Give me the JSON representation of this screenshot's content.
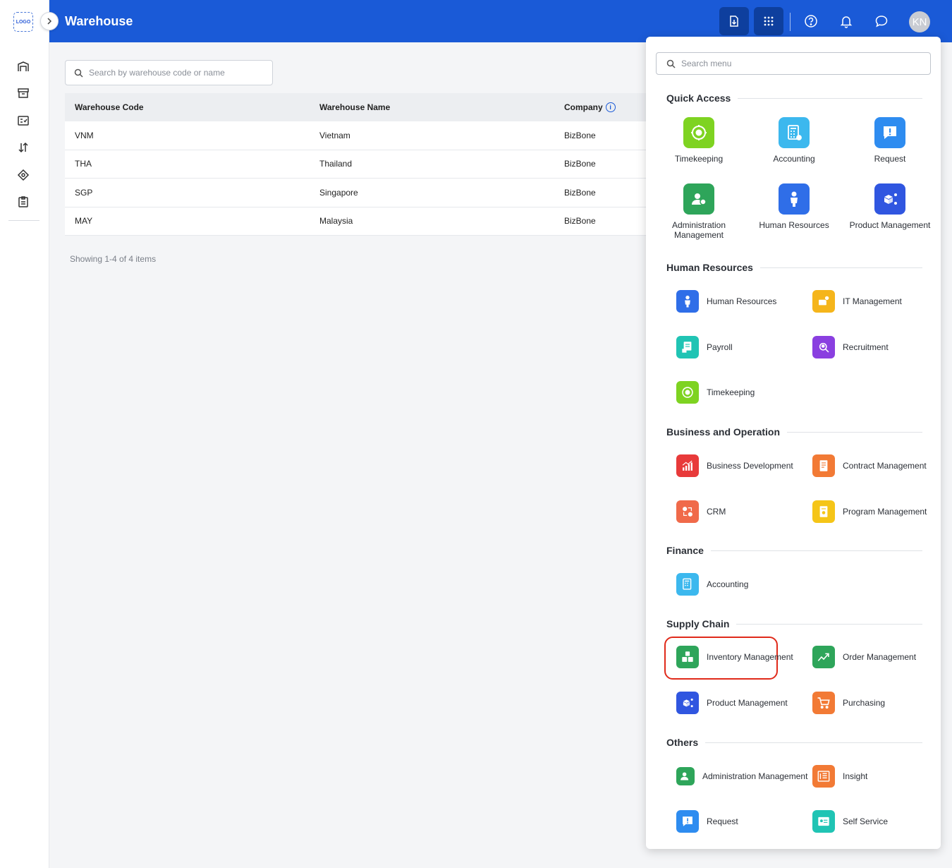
{
  "app": {
    "logo_text": "LOGO",
    "title": "Warehouse",
    "avatar_initials": "KN",
    "accent_color": "#1a5ad7"
  },
  "rail": {
    "icons": [
      "warehouse-icon",
      "archive-icon",
      "checklist-icon",
      "sort-icon",
      "tag-icon",
      "clipboard-icon"
    ]
  },
  "search": {
    "placeholder": "Search by warehouse code or name"
  },
  "table": {
    "columns": [
      "Warehouse Code",
      "Warehouse Name",
      "Company"
    ],
    "rows": [
      [
        "VNM",
        "Vietnam",
        "BizBone"
      ],
      [
        "THA",
        "Thailand",
        "BizBone"
      ],
      [
        "SGP",
        "Singapore",
        "BizBone"
      ],
      [
        "MAY",
        "Malaysia",
        "BizBone"
      ]
    ],
    "info_glyph": "i"
  },
  "footer": {
    "showing": "Showing 1-4 of 4 items"
  },
  "menu": {
    "search_placeholder": "Search menu",
    "quick_access": {
      "title": "Quick Access",
      "items": [
        {
          "label": "Timekeeping",
          "icon": "timekeeping-icon",
          "color": "#7ed321"
        },
        {
          "label": "Accounting",
          "icon": "accounting-icon",
          "color": "#3cb8ee"
        },
        {
          "label": "Request",
          "icon": "request-icon",
          "color": "#2e8cf0"
        },
        {
          "label": "Administration Management",
          "icon": "admin-icon",
          "color": "#2ea55a"
        },
        {
          "label": "Human Resources",
          "icon": "hr-icon",
          "color": "#2f6ee8"
        },
        {
          "label": "Product Management",
          "icon": "product-icon",
          "color": "#3056e0"
        }
      ]
    },
    "human_resources": {
      "title": "Human Resources",
      "items": [
        {
          "label": "Human Resources",
          "icon": "hr-icon",
          "color": "#2f6ee8"
        },
        {
          "label": "IT Management",
          "icon": "it-icon",
          "color": "#f5b51b"
        },
        {
          "label": "Payroll",
          "icon": "payroll-icon",
          "color": "#20c4b4"
        },
        {
          "label": "Recruitment",
          "icon": "recruitment-icon",
          "color": "#8a3fe0"
        },
        {
          "label": "Timekeeping",
          "icon": "timekeeping-icon",
          "color": "#7ed321"
        }
      ]
    },
    "business": {
      "title": "Business and Operation",
      "items": [
        {
          "label": "Business Development",
          "icon": "business-icon",
          "color": "#e83a3a"
        },
        {
          "label": "Contract Management",
          "icon": "contract-icon",
          "color": "#f27a35"
        },
        {
          "label": "CRM",
          "icon": "crm-icon",
          "color": "#f06a4a"
        },
        {
          "label": "Program Management",
          "icon": "program-icon",
          "color": "#f5c518"
        }
      ]
    },
    "finance": {
      "title": "Finance",
      "items": [
        {
          "label": "Accounting",
          "icon": "accounting-icon",
          "color": "#3cb8ee"
        }
      ]
    },
    "supply_chain": {
      "title": "Supply Chain",
      "items": [
        {
          "label": "Inventory Management",
          "icon": "inventory-icon",
          "color": "#2ea55a"
        },
        {
          "label": "Order Management",
          "icon": "order-icon",
          "color": "#2ea55a"
        },
        {
          "label": "Product Management",
          "icon": "product-icon",
          "color": "#3056e0"
        },
        {
          "label": "Purchasing",
          "icon": "purchasing-icon",
          "color": "#f27a35"
        }
      ]
    },
    "others": {
      "title": "Others",
      "items": [
        {
          "label": "Administration Management",
          "icon": "admin-icon",
          "color": "#2ea55a"
        },
        {
          "label": "Insight",
          "icon": "insight-icon",
          "color": "#f27a35"
        },
        {
          "label": "Request",
          "icon": "request-icon",
          "color": "#2e8cf0"
        },
        {
          "label": "Self Service",
          "icon": "self-service-icon",
          "color": "#20c4b4"
        }
      ]
    }
  }
}
